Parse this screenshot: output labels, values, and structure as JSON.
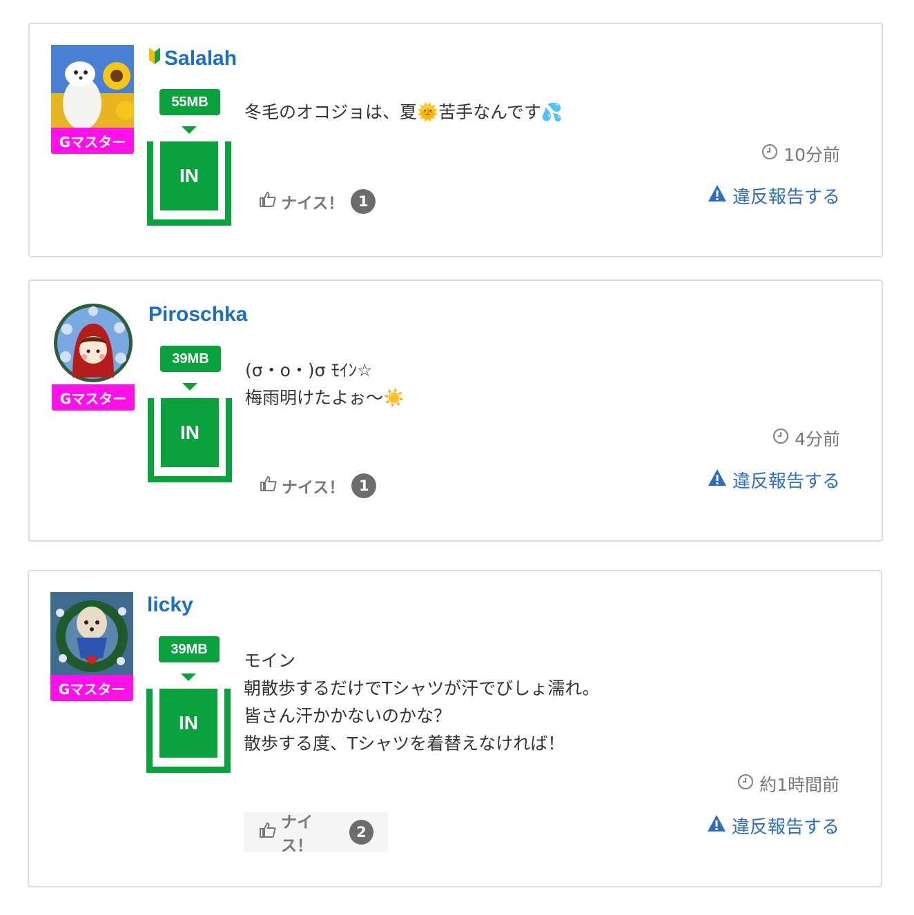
{
  "posts": [
    {
      "username": "Salalah",
      "rank": "Gマスター",
      "mb": "55MB",
      "in": "IN",
      "message": "冬毛のオコジョは、夏🌞苦手なんです💦",
      "time": "10分前",
      "report": "違反報告する",
      "nice_label": "ナイス！",
      "nice_count": "1",
      "beginner_icon": "beginner-leaf-icon"
    },
    {
      "username": "Piroschka",
      "rank": "Gマスター",
      "mb": "39MB",
      "in": "IN",
      "message": "(σ・ο・)σ ﾓｲﾝ☆\n梅雨明けたよぉ〜☀️",
      "time": "4分前",
      "report": "違反報告する",
      "nice_label": "ナイス！",
      "nice_count": "1"
    },
    {
      "username": "licky",
      "rank": "Gマスター",
      "mb": "39MB",
      "in": "IN",
      "message": "モイン\n朝散歩するだけでTシャツが汗でびしょ濡れ。\n皆さん汗かかないのかな？\n散歩する度、Tシャツを着替えなければ！",
      "time": "約1時間前",
      "report": "違反報告する",
      "nice_label": "ナイス！",
      "nice_count": "2"
    }
  ],
  "colors": {
    "username": "#1a6fc4",
    "rank_bg": "#ff12ea",
    "green": "#0aa23c",
    "report": "#2f6ebb",
    "muted": "#777777"
  }
}
